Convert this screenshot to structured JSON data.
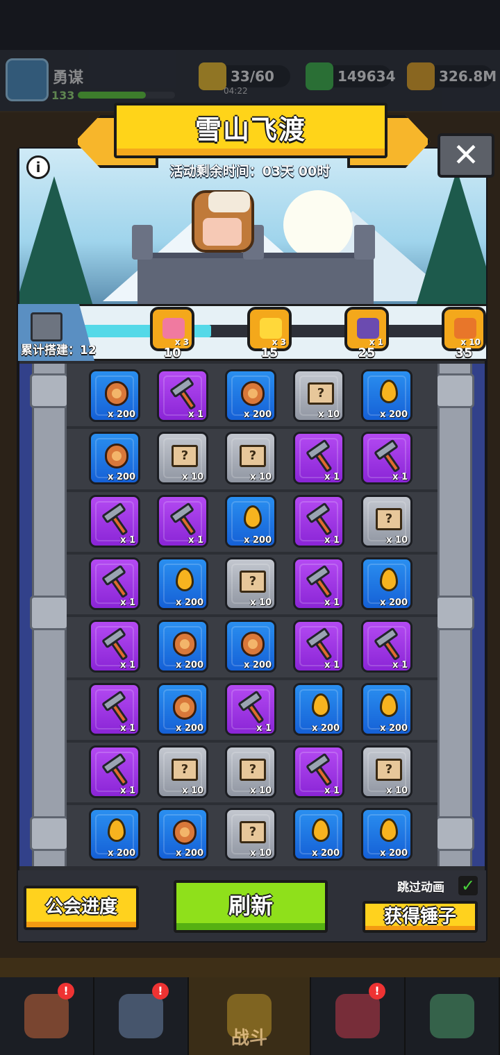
{
  "hud": {
    "player_name": "勇谋",
    "player_level": "133",
    "energy": "33/60",
    "energy_timer": "04:22",
    "gems": "149634",
    "gold": "326.8M"
  },
  "event": {
    "title": "雪山飞渡",
    "timer_text": "活动剩余时间：03天 00时",
    "info_symbol": "i",
    "close_symbol": "✕"
  },
  "progress": {
    "build_label": "累计搭建：12",
    "current": 12,
    "max": 35,
    "milestones": [
      {
        "threshold": "10",
        "qty": "x 3",
        "reward": "heart-chest-icon"
      },
      {
        "threshold": "15",
        "qty": "x 3",
        "reward": "star-icon"
      },
      {
        "threshold": "25",
        "qty": "x 1",
        "reward": "robot-chest-icon"
      },
      {
        "threshold": "35",
        "qty": "x 10",
        "reward": "ticket-icon"
      }
    ]
  },
  "grid": {
    "rows": [
      [
        {
          "item": "lion-coin",
          "qty": "x 200"
        },
        {
          "item": "hammer",
          "qty": "x 1"
        },
        {
          "item": "lion-coin",
          "qty": "x 200"
        },
        {
          "item": "map",
          "qty": "x 10"
        },
        {
          "item": "drop",
          "qty": "x 200"
        }
      ],
      [
        {
          "item": "lion-coin",
          "qty": "x 200"
        },
        {
          "item": "map",
          "qty": "x 10"
        },
        {
          "item": "map",
          "qty": "x 10"
        },
        {
          "item": "hammer",
          "qty": "x 1"
        },
        {
          "item": "hammer",
          "qty": "x 1"
        }
      ],
      [
        {
          "item": "hammer",
          "qty": "x 1"
        },
        {
          "item": "hammer",
          "qty": "x 1"
        },
        {
          "item": "drop",
          "qty": "x 200"
        },
        {
          "item": "hammer",
          "qty": "x 1"
        },
        {
          "item": "map",
          "qty": "x 10"
        }
      ],
      [
        {
          "item": "hammer",
          "qty": "x 1"
        },
        {
          "item": "drop",
          "qty": "x 200"
        },
        {
          "item": "map",
          "qty": "x 10"
        },
        {
          "item": "hammer",
          "qty": "x 1"
        },
        {
          "item": "drop",
          "qty": "x 200"
        }
      ],
      [
        {
          "item": "hammer",
          "qty": "x 1"
        },
        {
          "item": "lion-coin",
          "qty": "x 200"
        },
        {
          "item": "lion-coin",
          "qty": "x 200"
        },
        {
          "item": "hammer",
          "qty": "x 1"
        },
        {
          "item": "hammer",
          "qty": "x 1"
        }
      ],
      [
        {
          "item": "hammer",
          "qty": "x 1"
        },
        {
          "item": "lion-coin",
          "qty": "x 200"
        },
        {
          "item": "hammer",
          "qty": "x 1"
        },
        {
          "item": "drop",
          "qty": "x 200"
        },
        {
          "item": "drop",
          "qty": "x 200"
        }
      ],
      [
        {
          "item": "hammer",
          "qty": "x 1"
        },
        {
          "item": "map",
          "qty": "x 10"
        },
        {
          "item": "map",
          "qty": "x 10"
        },
        {
          "item": "hammer",
          "qty": "x 1"
        },
        {
          "item": "map",
          "qty": "x 10"
        }
      ],
      [
        {
          "item": "drop",
          "qty": "x 200"
        },
        {
          "item": "lion-coin",
          "qty": "x 200"
        },
        {
          "item": "map",
          "qty": "x 10"
        },
        {
          "item": "drop",
          "qty": "x 200"
        },
        {
          "item": "drop",
          "qty": "x 200"
        }
      ]
    ]
  },
  "controls": {
    "guild_progress": "公会进度",
    "refresh": "刷新",
    "skip_animation": "跳过动画",
    "skip_checked": "✓",
    "get_hammer": "获得锤子"
  },
  "bottom_nav": {
    "battle_label": "战斗",
    "badge": "!"
  },
  "colors": {
    "tile_blue": "#1f7be8",
    "tile_purple": "#a23ae6",
    "tile_gray": "#a9aeb8",
    "banner_yellow": "#ffd419",
    "refresh_green": "#8fe01b"
  }
}
